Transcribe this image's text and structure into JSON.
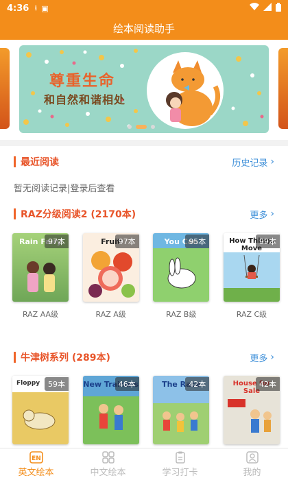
{
  "status_bar": {
    "time": "4:36"
  },
  "app_title": "绘本阅读助手",
  "banner": {
    "headline": "尊重生命",
    "subline": "和自然和谐相处",
    "slide_count": 3,
    "active_slide": 2
  },
  "recent": {
    "title": "最近阅读",
    "history_label": "历史记录",
    "empty_text": "暂无阅读记录|登录后查看"
  },
  "raz": {
    "title": "RAZ分级阅读2 (2170本)",
    "more_label": "更多",
    "books": [
      {
        "cover_text": "Rain Fairy",
        "count": "97本",
        "label": "RAZ AA级",
        "bg": "#8fbf6a"
      },
      {
        "cover_text": "Fruit",
        "count": "97本",
        "label": "RAZ A级",
        "bg": "#c9392d"
      },
      {
        "cover_text": "You Can",
        "count": "95本",
        "label": "RAZ B级",
        "bg": "#7cc26d"
      },
      {
        "cover_text": "How Things Move",
        "count": "99本",
        "label": "RAZ C级",
        "bg": "#9ccfee"
      }
    ]
  },
  "oxford": {
    "title": "牛津树系列 (289本)",
    "more_label": "更多",
    "books": [
      {
        "cover_text": "Floppy",
        "count": "59本",
        "bg": "#e9c964"
      },
      {
        "cover_text": "New Trainers",
        "count": "46本",
        "bg": "#5fa6d6"
      },
      {
        "cover_text": "The Race",
        "count": "42本",
        "bg": "#8dc1e8"
      },
      {
        "cover_text": "House for Sale",
        "count": "42本",
        "bg": "#e7e3d8"
      }
    ]
  },
  "tabs": [
    {
      "label": "英文绘本",
      "active": true
    },
    {
      "label": "中文绘本",
      "active": false
    },
    {
      "label": "学习打卡",
      "active": false
    },
    {
      "label": "我的",
      "active": false
    }
  ]
}
